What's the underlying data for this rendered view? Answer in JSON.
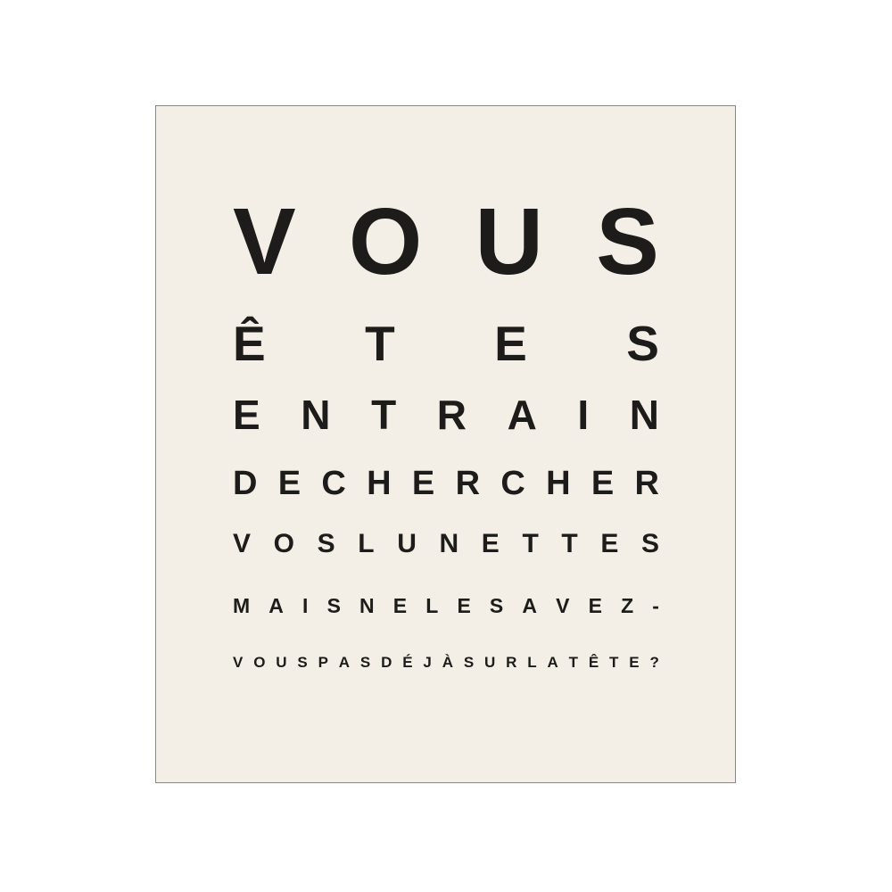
{
  "poster": {
    "lines": [
      "VOUS",
      "ÊTES",
      "EN TRAIN",
      "DE CHERCHER",
      "VOS LUNETTES",
      "MAIS NE LES AVEZ-",
      "VOUS PAS DÉJÀ SUR LA TÊTE ?"
    ],
    "colors": {
      "background": "#f3efe6",
      "text": "#1e1c1b",
      "border": "#8a8782"
    }
  }
}
